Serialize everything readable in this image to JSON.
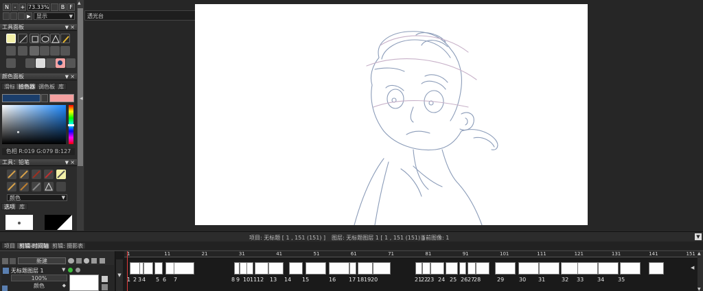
{
  "top_toolbar": {
    "n_label": "N",
    "zoom": "73.33%",
    "b_label": "B",
    "f_label": "F",
    "display_dropdown": "显示"
  },
  "tool_panel": {
    "title": "工具面板"
  },
  "color_panel": {
    "title": "颜色面板",
    "tabs": [
      "滑标",
      "拾色器",
      "调色板",
      "库"
    ],
    "active_tab": 1,
    "primary_color": "#1b3e6b",
    "secondary_color": "#f4a0a0",
    "readout": "色相 R:019 G:079 B:127"
  },
  "pencil_panel": {
    "title": "工具：铅笔",
    "color_dropdown": "颜色"
  },
  "options_tabs": [
    "选项",
    "库"
  ],
  "light_table": {
    "title": "透光台"
  },
  "status_bar": {
    "project": "项目: 无标题 [ 1 , 151  (151) ]",
    "layer": "图层: 无标题图层 1 [ 1 , 151  (151) ]",
    "current_image": "当前图像: 1"
  },
  "timeline_tabs": [
    "项目",
    "剪辑-时间轴",
    "剪辑: 摄影表"
  ],
  "timeline_active_tab": 1,
  "layer_panel": {
    "new_button": "新建",
    "layer_name": "无标题图层 1",
    "opacity": "100%",
    "color_label": "颜色"
  },
  "ruler_ticks": [
    "1",
    "11",
    "21",
    "31",
    "41",
    "51",
    "61",
    "71",
    "81",
    "91",
    "101",
    "111",
    "121",
    "131",
    "141",
    "151"
  ],
  "frame_numbers": [
    "1",
    "2",
    "3",
    "4",
    "5",
    "6",
    "7",
    "8",
    "9",
    "10",
    "11",
    "12",
    "13",
    "14",
    "15",
    "16",
    "17",
    "18",
    "19",
    "20",
    "21",
    "22",
    "23",
    "24",
    "25",
    "26",
    "27",
    "28",
    "29",
    "30",
    "31",
    "32",
    "33",
    "34",
    "35"
  ]
}
